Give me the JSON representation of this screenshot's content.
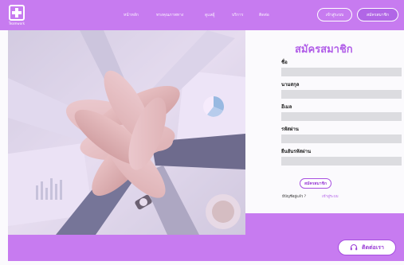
{
  "brand": {
    "logo_text": "Teamwork",
    "accent": "#c77bf0",
    "accent_dark": "#a64ee0"
  },
  "nav": {
    "links": [
      "หน้าหลัก",
      "ทรงคุณภาพทาง",
      "ดูแลผู้",
      "บริการ",
      "ติดต่อ"
    ],
    "login_label": "เข้าสู่ระบบ",
    "register_label": "สมัครสมาชิก"
  },
  "hero": {
    "icon": "stacked-hands-photo"
  },
  "form": {
    "title": "สมัครสมาชิก",
    "fields": [
      {
        "label": "ชื่อ",
        "value": ""
      },
      {
        "label": "นามสกุล",
        "value": ""
      },
      {
        "label": "อีเมล",
        "value": ""
      },
      {
        "label": "รหัสผ่าน",
        "value": ""
      },
      {
        "label": "ยืนยันรหัสผ่าน",
        "value": ""
      }
    ],
    "submit_label": "สมัครสมาชิก",
    "have_account_text": "มีบัญชีอยู่แล้ว ?",
    "login_link": "เข้าสู่ระบบ"
  },
  "footer": {
    "contact_label": "ติดต่อเรา",
    "contact_icon": "headset-icon"
  }
}
